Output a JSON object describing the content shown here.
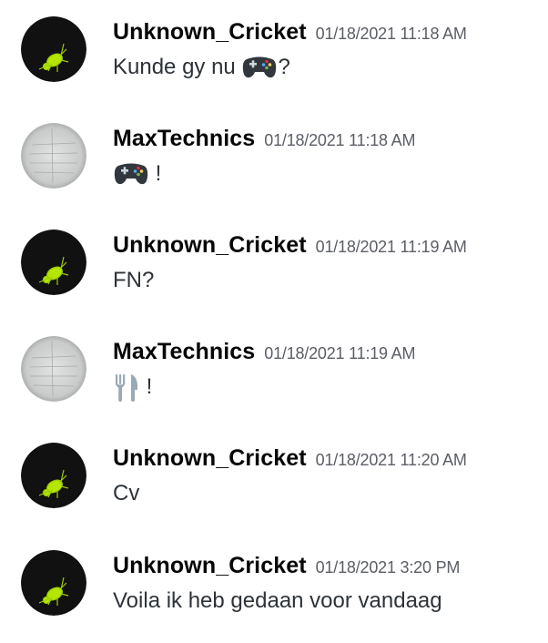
{
  "messages": [
    {
      "author": "Unknown_Cricket",
      "avatar": "cricket-avatar",
      "timestamp": "01/18/2021 11:18 AM",
      "before": "Kunde gy nu ",
      "emoji": "video-game-emoji",
      "after": "?"
    },
    {
      "author": "MaxTechnics",
      "avatar": "paper-avatar",
      "timestamp": "01/18/2021 11:18 AM",
      "before": "",
      "emoji": "video-game-emoji",
      "after": " !"
    },
    {
      "author": "Unknown_Cricket",
      "avatar": "cricket-avatar",
      "timestamp": "01/18/2021 11:19 AM",
      "before": "FN?",
      "emoji": "",
      "after": ""
    },
    {
      "author": "MaxTechnics",
      "avatar": "paper-avatar",
      "timestamp": "01/18/2021 11:19 AM",
      "before": "",
      "emoji": "fork-and-knife-emoji",
      "after": " !"
    },
    {
      "author": "Unknown_Cricket",
      "avatar": "cricket-avatar",
      "timestamp": "01/18/2021 11:20 AM",
      "before": "Cv",
      "emoji": "",
      "after": ""
    },
    {
      "author": "Unknown_Cricket",
      "avatar": "cricket-avatar",
      "timestamp": "01/18/2021 3:20 PM",
      "before": "Voila ik heb gedaan voor vandaag",
      "emoji": "",
      "after": ""
    }
  ]
}
